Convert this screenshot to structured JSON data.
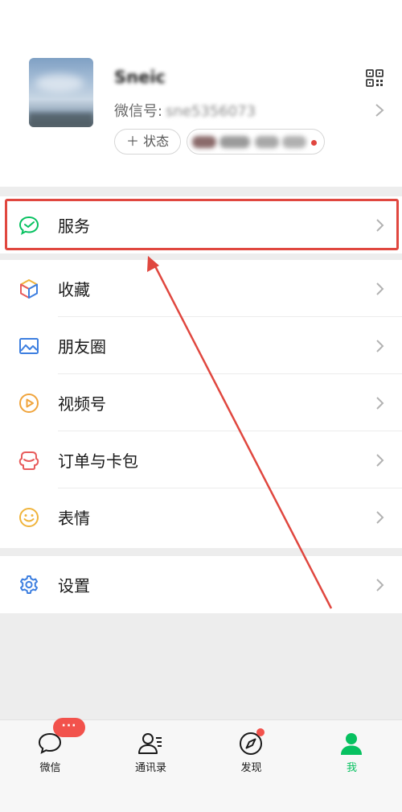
{
  "profile": {
    "nickname": "Sneic",
    "wechat_id_label": "微信号:",
    "wechat_id_value": "sne5356073",
    "status_button": "＋ 状态"
  },
  "menu": {
    "services": "服务",
    "favorites": "收藏",
    "moments": "朋友圈",
    "channels": "视频号",
    "orders": "订单与卡包",
    "stickers": "表情",
    "settings": "设置"
  },
  "tabbar": {
    "chats_label": "微信",
    "chats_badge": "···",
    "contacts_label": "通讯录",
    "discover_label": "发现",
    "me_label": "我"
  },
  "colors": {
    "accent_green": "#07c160",
    "annotation_red": "#e0473f",
    "badge_red": "#f2524c"
  },
  "icons": [
    "qr-code-icon",
    "chevron-right-icon",
    "services-icon",
    "favorites-cube-icon",
    "moments-image-icon",
    "channels-play-icon",
    "orders-wallet-icon",
    "stickers-smile-icon",
    "settings-gear-icon",
    "chat-bubble-icon",
    "contacts-person-icon",
    "discover-compass-icon",
    "me-person-icon"
  ]
}
